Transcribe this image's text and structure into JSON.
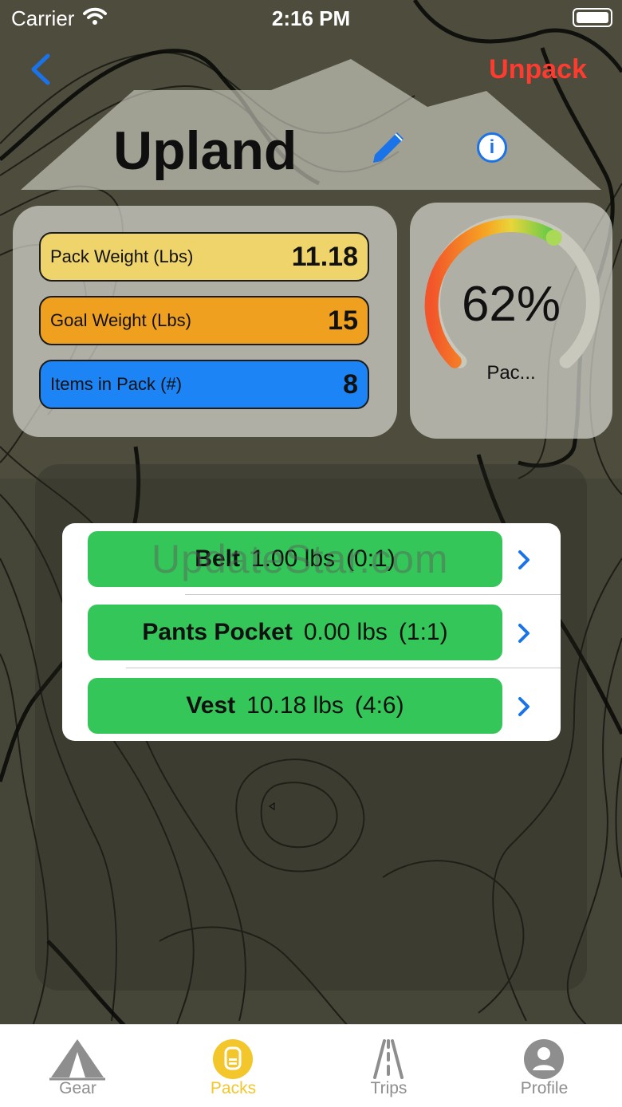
{
  "status": {
    "carrier": "Carrier",
    "time": "2:16 PM"
  },
  "nav": {
    "unpack_label": "Unpack"
  },
  "pack": {
    "name": "Upland",
    "stats": [
      {
        "label": "Pack Weight (Lbs)",
        "value": "11.18",
        "color": "#efd46b"
      },
      {
        "label": "Goal Weight (Lbs)",
        "value": "15",
        "color": "#f0a01f"
      },
      {
        "label": "Items in Pack (#)",
        "value": "8",
        "color": "#1d84f5"
      }
    ],
    "gauge": {
      "percent_text": "62%",
      "label": "Pac...",
      "fraction": 0.62
    }
  },
  "containers": [
    {
      "name": "Belt",
      "weight": "1.00 lbs",
      "count": "(0:1)"
    },
    {
      "name": "Pants Pocket",
      "weight": "0.00 lbs",
      "count": "(1:1)"
    },
    {
      "name": "Vest",
      "weight": "10.18 lbs",
      "count": "(4:6)"
    }
  ],
  "watermark": "UpdateStar.com",
  "tabs": [
    {
      "label": "Gear",
      "icon": "tent-icon",
      "active": false
    },
    {
      "label": "Packs",
      "icon": "backpack-icon",
      "active": true
    },
    {
      "label": "Trips",
      "icon": "road-icon",
      "active": false
    },
    {
      "label": "Profile",
      "icon": "person-icon",
      "active": false
    }
  ],
  "colors": {
    "accent": "#f3c62b",
    "unpack": "#ff3b30",
    "row": "#35c659",
    "link": "#1a73e8"
  }
}
